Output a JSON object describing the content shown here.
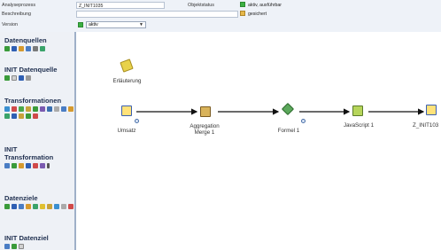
{
  "header": {
    "rows": [
      {
        "label": "Analyseprozess",
        "value": "Z_INIT1035"
      },
      {
        "label": "Beschreibung",
        "value": ""
      },
      {
        "label": "Version",
        "value": "aktiv"
      }
    ],
    "status_label": "Objektstatus",
    "status_value": "aktiv, ausführbar",
    "lock_value": "gesichert",
    "colors": {
      "status": "#3cb043",
      "lock": "#e6b84a"
    }
  },
  "sidebar": {
    "sections": [
      {
        "title": "Datenquellen",
        "icons": [
          "green-cube-icon",
          "blue-db-icon",
          "infocube-icon",
          "table-icon",
          "query-icon",
          "link-icon"
        ]
      },
      {
        "title": "INIT Datenquelle",
        "icons": [
          "source-icon",
          "file-icon",
          "grid-icon",
          "doc-icon"
        ]
      },
      {
        "title": "Transformationen",
        "icons": [
          "filter-icon",
          "join-icon",
          "sort-icon",
          "aggregate-icon",
          "formula-icon",
          "abap-icon",
          "union-icon",
          "list-icon",
          "merge-icon",
          "split-icon",
          "calc-icon",
          "list2-icon",
          "chart-icon",
          "cube-icon",
          "delete-icon"
        ]
      },
      {
        "title": "INIT Transformation",
        "icons": [
          "flow-icon",
          "plus-icon",
          "split2-icon",
          "box-icon",
          "funnel-icon",
          "js-icon",
          "bar-icon"
        ]
      },
      {
        "title": "Datenziele",
        "icons": [
          "cube-target-icon",
          "db-target-icon",
          "table-target-icon",
          "export-icon",
          "file-target-icon",
          "warn-icon",
          "chart-target-icon",
          "link-target-icon",
          "grid-target-icon",
          "delete-target-icon"
        ]
      },
      {
        "title": "INIT Datenziel",
        "icons": [
          "target-a-icon",
          "target-b-icon",
          "target-c-icon"
        ]
      }
    ]
  },
  "canvas": {
    "nodes": [
      {
        "id": "erlauterung",
        "label": "Erläuterung",
        "icon": "pencil-note-icon"
      },
      {
        "id": "umsatz",
        "label": "Umsatz",
        "icon": "datasource-icon"
      },
      {
        "id": "aggregation",
        "label": "Aggregation\nMerge 1",
        "icon": "aggregation-icon"
      },
      {
        "id": "formel",
        "label": "Formel 1",
        "icon": "formula-icon"
      },
      {
        "id": "javascript",
        "label": "JavaScript 1",
        "icon": "script-icon"
      },
      {
        "id": "target",
        "label": "Z_INIT103",
        "icon": "datatarget-icon"
      }
    ]
  }
}
